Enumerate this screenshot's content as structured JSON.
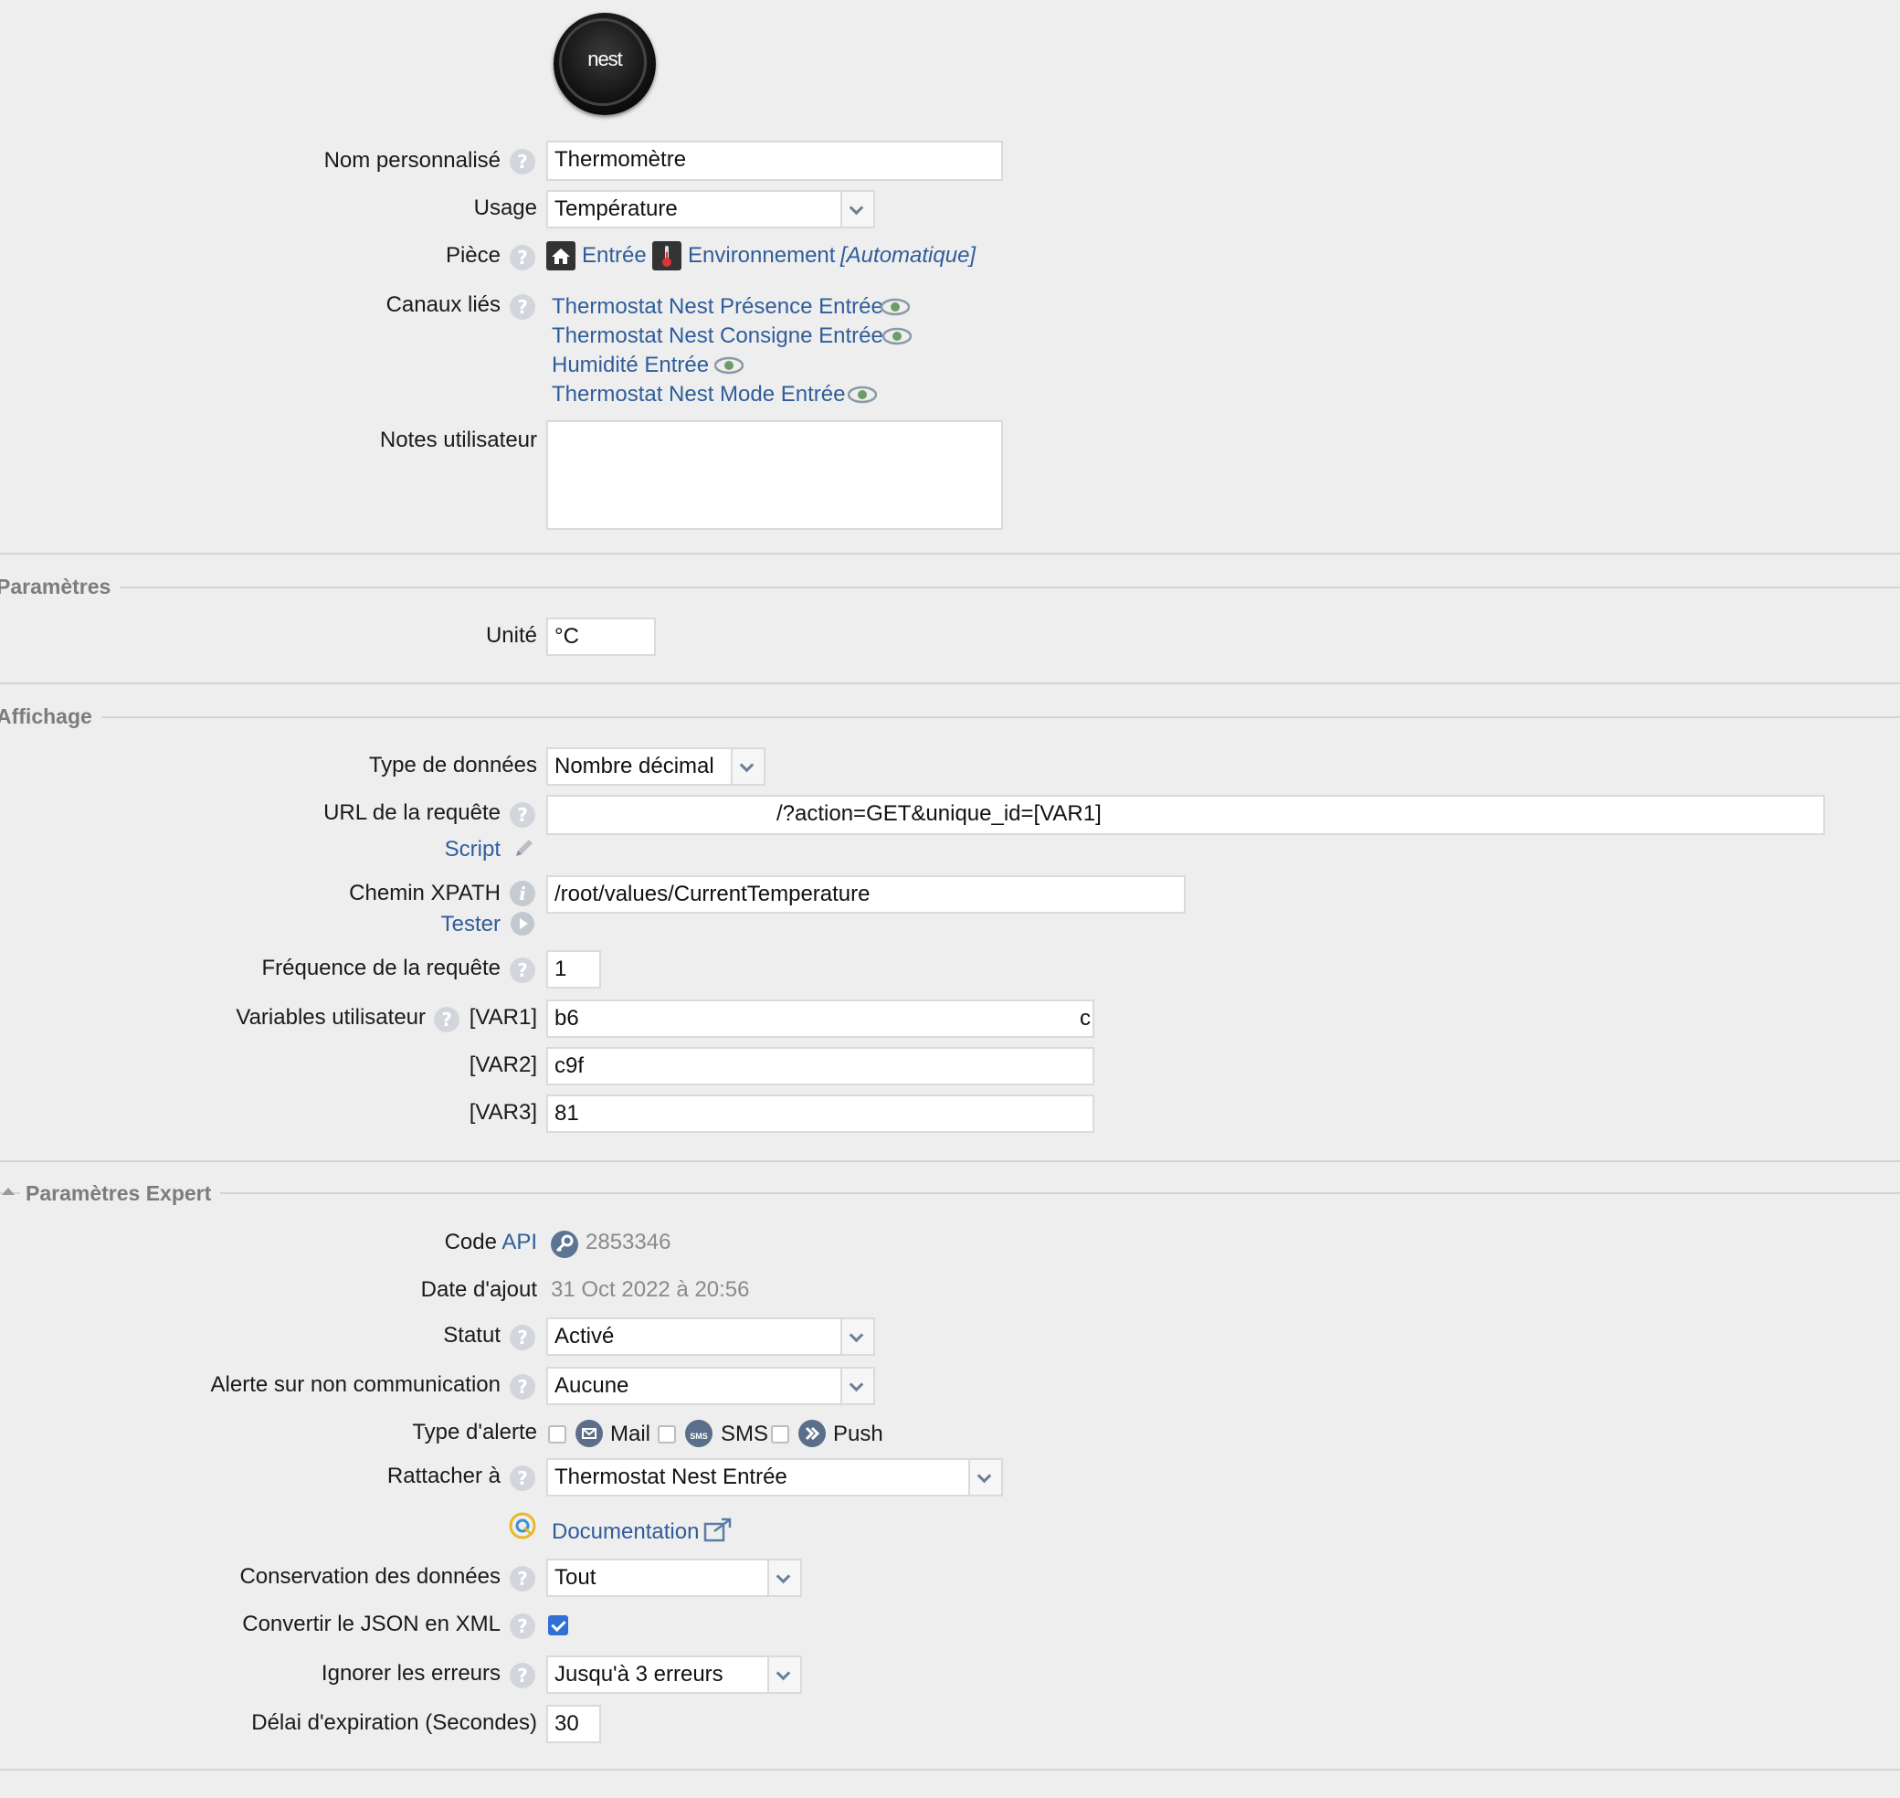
{
  "device": {
    "logo_text": "nest",
    "fields": {
      "name": {
        "label": "Nom personnalisé",
        "value": "Thermomètre"
      },
      "usage": {
        "label": "Usage",
        "value": "Température"
      },
      "room": {
        "label": "Pièce",
        "room_name": "Entrée",
        "category": "Environnement",
        "mode": "[Automatique]"
      },
      "linked": {
        "label": "Canaux liés",
        "items": [
          "Thermostat Nest Présence Entrée",
          "Thermostat Nest Consigne Entrée",
          "Humidité Entrée",
          "Thermostat Nest Mode Entrée"
        ]
      },
      "notes": {
        "label": "Notes utilisateur",
        "value": ""
      }
    }
  },
  "parametres": {
    "title": "Paramètres",
    "unit": {
      "label": "Unité",
      "value": "°C"
    }
  },
  "affichage": {
    "title": "Affichage",
    "data_type": {
      "label": "Type de données",
      "value": "Nombre décimal"
    },
    "url": {
      "label": "URL de la requête",
      "value": "/?action=GET&unique_id=[VAR1]"
    },
    "script": {
      "label": "Script"
    },
    "xpath": {
      "label": "Chemin XPATH",
      "value": "/root/values/CurrentTemperature"
    },
    "tester": {
      "label": "Tester"
    },
    "frequency": {
      "label": "Fréquence de la requête",
      "value": "1"
    },
    "variables": {
      "label": "Variables utilisateur",
      "var1": {
        "label": "[VAR1]",
        "value": "b6",
        "tail": "c"
      },
      "var2": {
        "label": "[VAR2]",
        "value": "c9f"
      },
      "var3": {
        "label": "[VAR3]",
        "value": "81"
      }
    }
  },
  "expert": {
    "title": "Paramètres Expert",
    "api": {
      "label": "Code",
      "link": "API",
      "value": "2853346"
    },
    "date": {
      "label": "Date d'ajout",
      "value": "31 Oct 2022 à 20:56"
    },
    "status": {
      "label": "Statut",
      "value": "Activé"
    },
    "alert": {
      "label": "Alerte sur non communication",
      "value": "Aucune"
    },
    "alert_type": {
      "label": "Type d'alerte",
      "mail": "Mail",
      "sms": "SMS",
      "sms_icon": "SMS",
      "push": "Push"
    },
    "attach": {
      "label": "Rattacher à",
      "value": "Thermostat Nest Entrée"
    },
    "documentation": {
      "label": "Documentation"
    },
    "retention": {
      "label": "Conservation des données",
      "value": "Tout"
    },
    "json_xml": {
      "label": "Convertir le JSON en XML",
      "checked": true
    },
    "ignore_errors": {
      "label": "Ignorer les erreurs",
      "value": "Jusqu'à 3 erreurs"
    },
    "timeout": {
      "label": "Délai d'expiration (Secondes)",
      "value": "30"
    }
  },
  "icons": {
    "help": "?",
    "info": "i"
  }
}
